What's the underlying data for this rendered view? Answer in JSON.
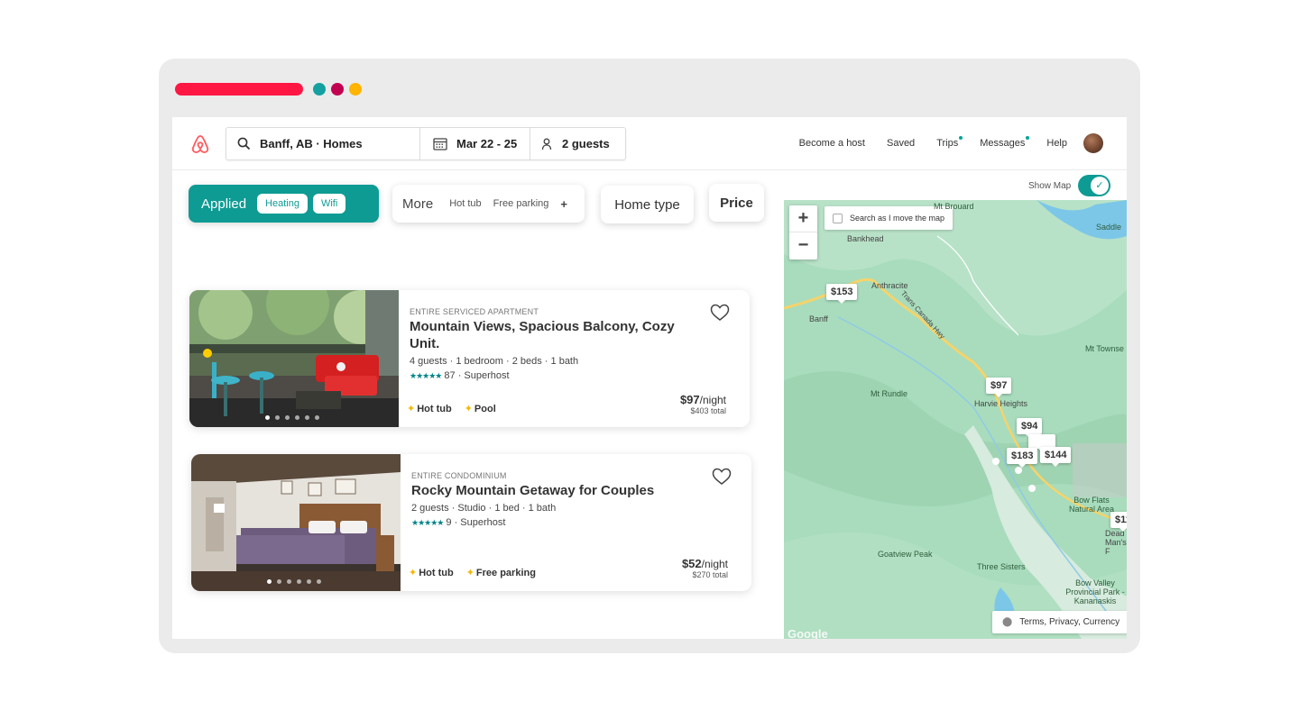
{
  "colors": {
    "brand": "#ff5a5f",
    "accent": "#0e9b94",
    "window_bar": "#ff1744",
    "dot1": "#14a0a0",
    "dot2": "#c20050",
    "dot3": "#ffb400"
  },
  "header": {
    "logo_icon": "airbnb-logo-icon",
    "search": {
      "location": "Banff, AB · Homes",
      "dates": "Mar 22 - 25",
      "guests": "2 guests"
    },
    "nav": [
      "Become a host",
      "Saved",
      "Trips",
      "Messages",
      "Help"
    ]
  },
  "filters": {
    "applied_label": "Applied",
    "applied_chips": [
      "Heating",
      "Wifi"
    ],
    "more_label": "More",
    "more_options": [
      "Hot tub",
      "Free parking"
    ],
    "more_plus": "+",
    "home_type": "Home type",
    "price": "Price"
  },
  "listings": [
    {
      "type": "ENTIRE SERVICED APARTMENT",
      "title": "Mountain Views, Spacious Balcony, Cozy Unit.",
      "details": "4 guests · 1 bedroom · 2 beds · 1 bath",
      "stars": "★★★★★",
      "reviews": "87 · Superhost",
      "amenities": [
        "Hot tub",
        "Pool"
      ],
      "price": "$97",
      "per": "/night",
      "total": "$403 total"
    },
    {
      "type": "ENTIRE CONDOMINIUM",
      "title": "Rocky Mountain Getaway for Couples",
      "details": "2 guests · Studio · 1 bed · 1 bath",
      "stars": "★★★★★",
      "reviews": "9 · Superhost",
      "amenities": [
        "Hot tub",
        "Free parking"
      ],
      "price": "$52",
      "per": "/night",
      "total": "$270 total"
    }
  ],
  "map": {
    "show_map_label": "Show Map",
    "show_map_on": true,
    "search_as_move": "Search as I move the map",
    "zoom_in": "+",
    "zoom_out": "−",
    "price_pins": [
      "$153",
      "$97",
      "$94",
      "$183",
      "$144",
      "$11"
    ],
    "places": [
      "Bankhead",
      "Anthracite",
      "Banff",
      "Trans Canada Hwy",
      "Mt Rundle",
      "Harvie Heights",
      "Mt Townse",
      "Saddle",
      "Bow Flats Natural Area",
      "Goatview Peak",
      "Three Sisters",
      "Bow Valley Provincial Park - Kananaskis",
      "Mt Brouard",
      "Dead Man's F"
    ],
    "terms": "Terms, Privacy, Currency",
    "attribution": "Google"
  }
}
